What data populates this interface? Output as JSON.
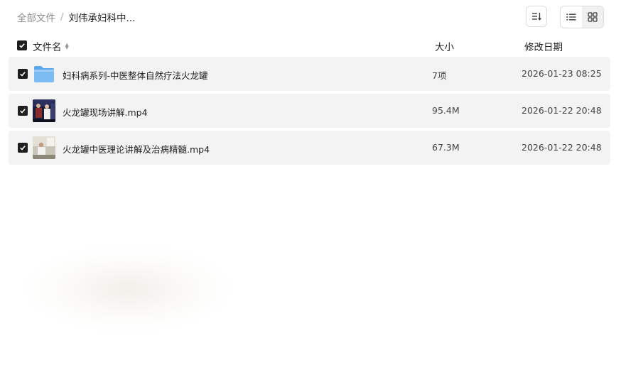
{
  "breadcrumb": {
    "root": "全部文件",
    "separator": "/",
    "current": "刘伟承妇科中..."
  },
  "toolbar": {
    "sort_icon": "sort-icon",
    "view_list_icon": "list-view-icon",
    "view_grid_icon": "grid-view-icon",
    "active_view": "list"
  },
  "table": {
    "headers": {
      "name": "文件名",
      "size": "大小",
      "date": "修改日期"
    },
    "select_all_checked": true,
    "rows": [
      {
        "name": "妇科病系列-中医整体自然疗法火龙罐",
        "size": "7项",
        "date": "2026-01-23 08:25",
        "type": "folder",
        "icon": "folder-icon",
        "checked": true
      },
      {
        "name": "火龙罐现场讲解.mp4",
        "size": "95.4M",
        "date": "2026-01-22 20:48",
        "type": "video",
        "icon": "video-thumbnail",
        "checked": true
      },
      {
        "name": "火龙罐中医理论讲解及治病精髓.mp4",
        "size": "67.3M",
        "date": "2026-01-22 20:48",
        "type": "video",
        "icon": "video-thumbnail",
        "checked": true
      }
    ]
  },
  "colors": {
    "row_bg": "#f3f3f3",
    "checkbox": "#1f1f1f",
    "folder": "#6fb3f0",
    "muted_text": "#8c8c8c"
  }
}
